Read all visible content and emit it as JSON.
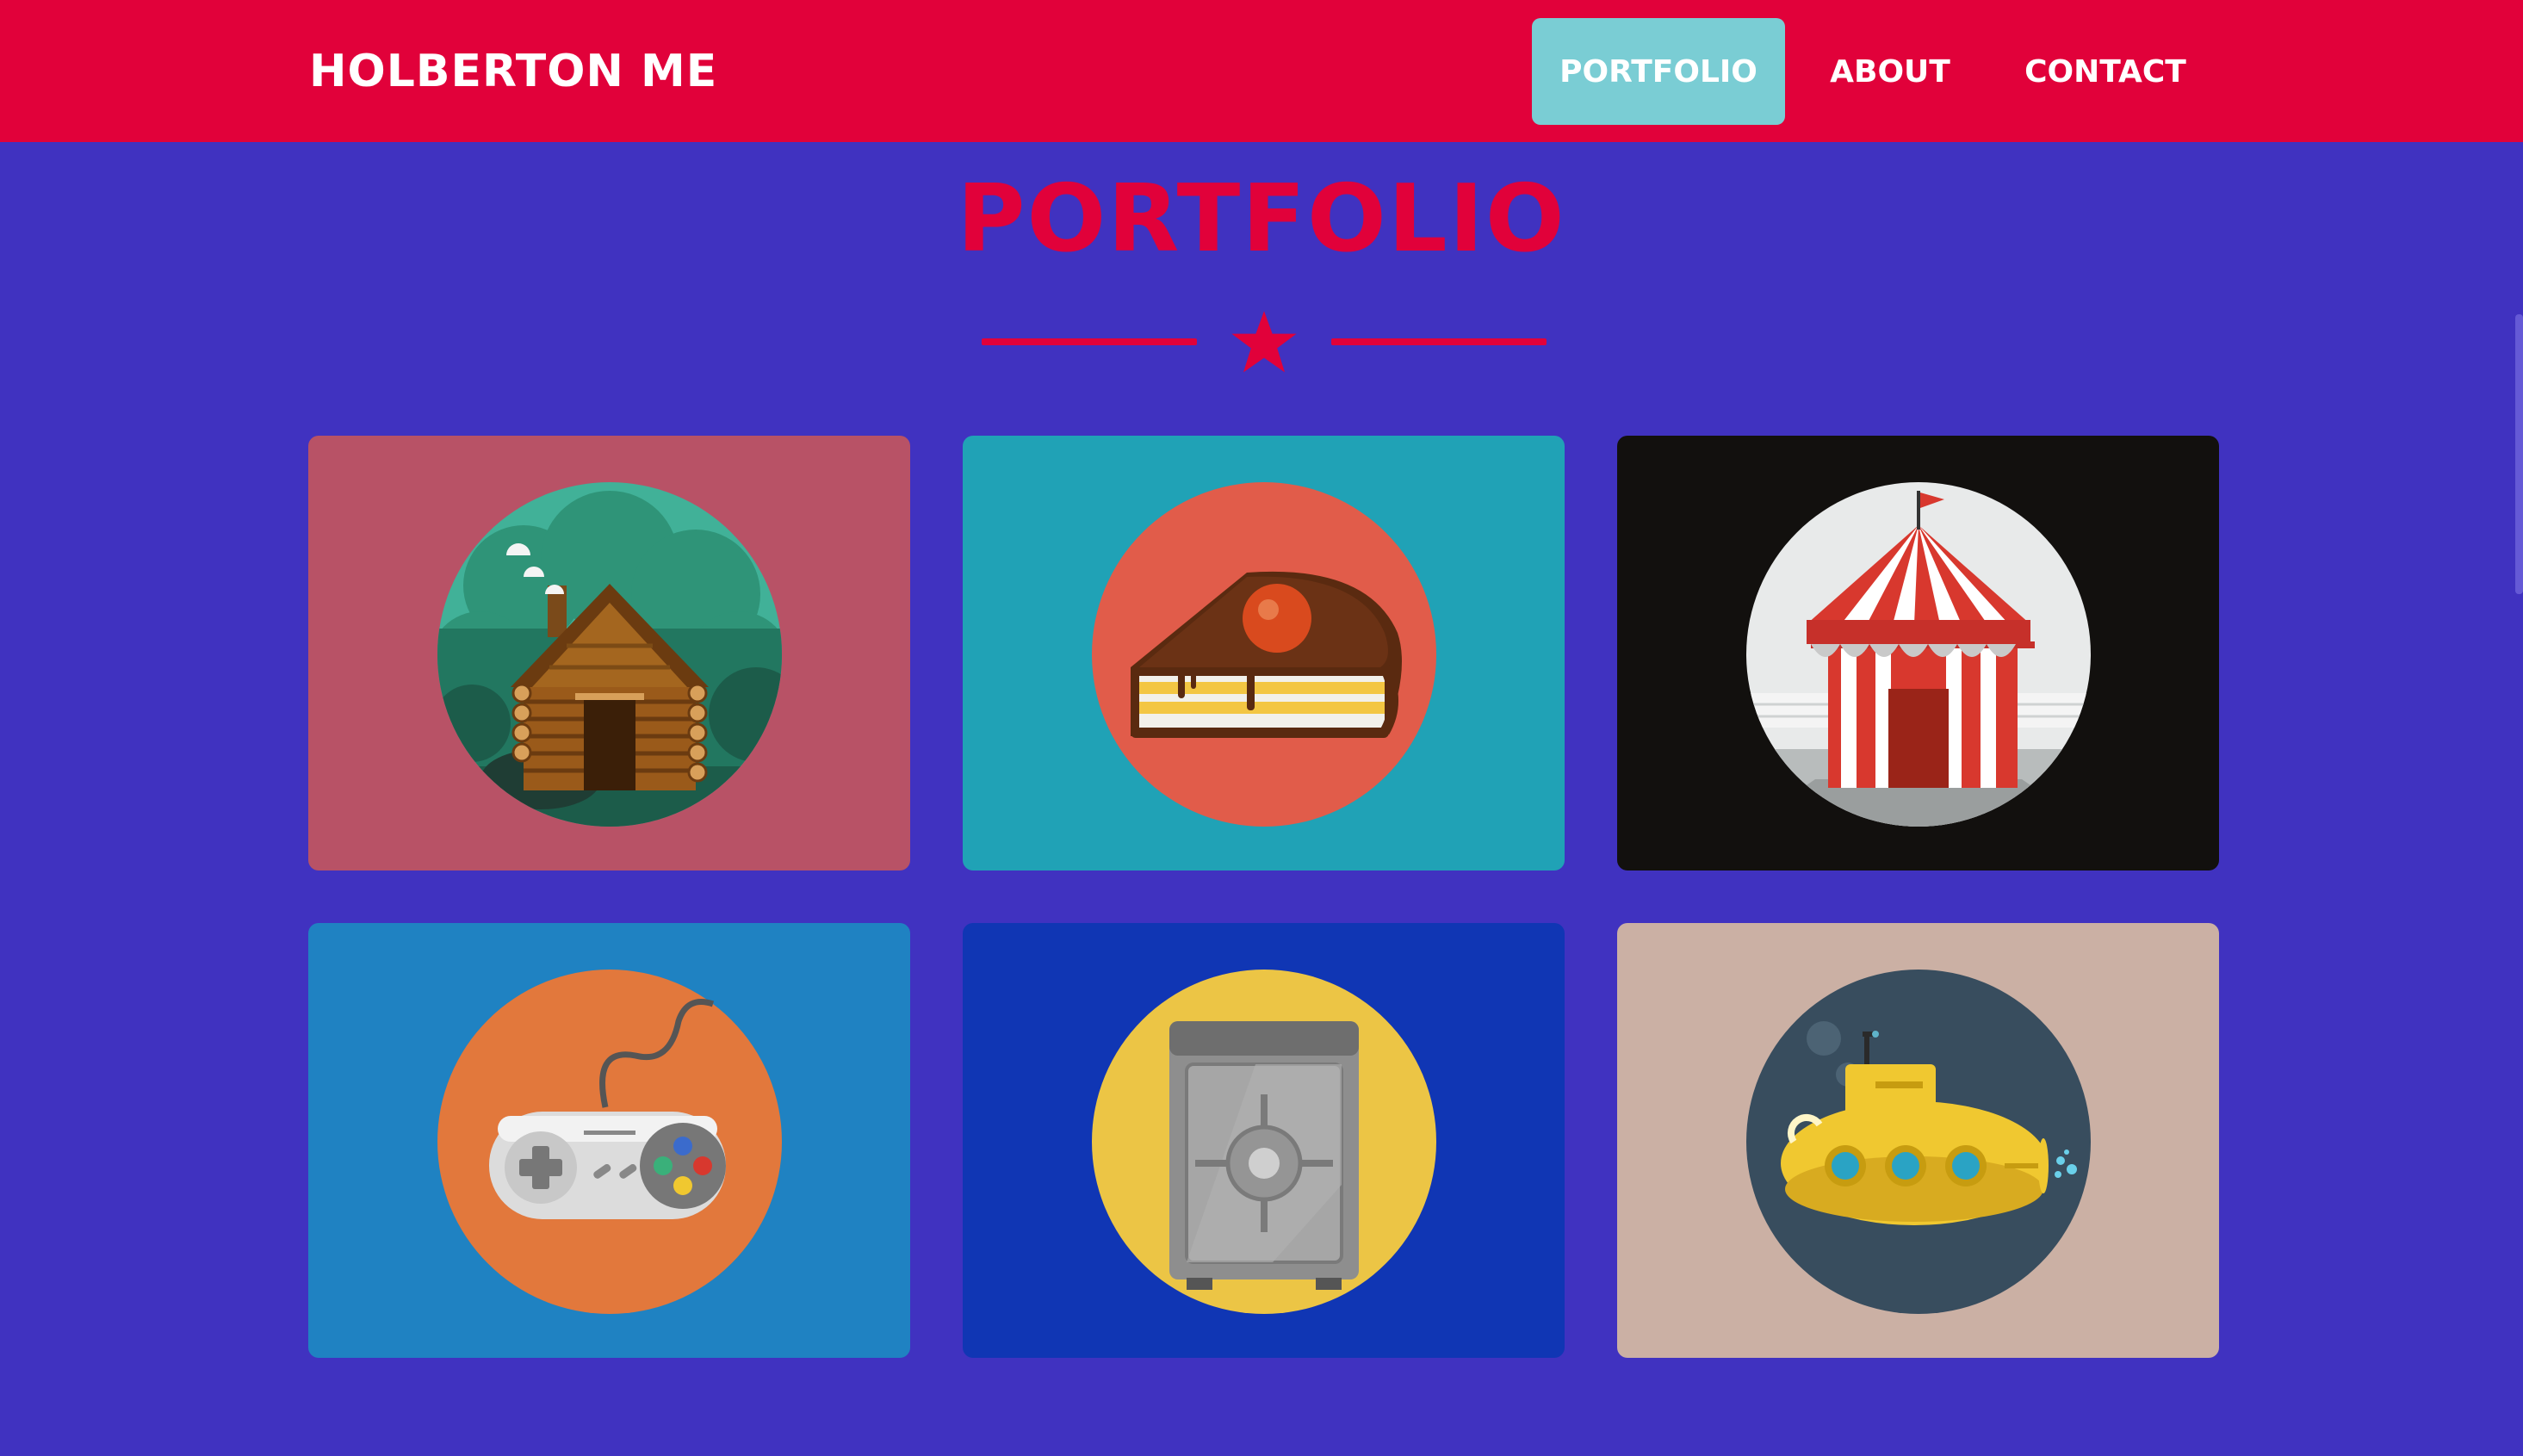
{
  "header": {
    "brand": "HOLBERTON ME",
    "nav": [
      {
        "label": "PORTFOLIO",
        "active": true
      },
      {
        "label": "ABOUT",
        "active": false
      },
      {
        "label": "CONTACT",
        "active": false
      }
    ]
  },
  "section": {
    "title": "PORTFOLIO",
    "divider_icon": "star-icon"
  },
  "portfolio": {
    "items": [
      {
        "icon": "log-cabin-icon",
        "card_color": "#b85266",
        "circle_color": "#41b198"
      },
      {
        "icon": "cake-slice-icon",
        "card_color": "#20a2b6",
        "circle_color": "#e15c4a"
      },
      {
        "icon": "circus-tent-icon",
        "card_color": "#12100e",
        "circle_color": "#e8eaea"
      },
      {
        "icon": "game-controller-icon",
        "card_color": "#1f82c2",
        "circle_color": "#e2783c"
      },
      {
        "icon": "safe-icon",
        "card_color": "#1036b4",
        "circle_color": "#ecc545"
      },
      {
        "icon": "submarine-icon",
        "card_color": "#cbb0a4",
        "circle_color": "#384d5e"
      }
    ]
  },
  "colors": {
    "background": "#4032c0",
    "header": "#e1013a",
    "nav_active": "#7acdd4",
    "accent": "#e1013a"
  }
}
